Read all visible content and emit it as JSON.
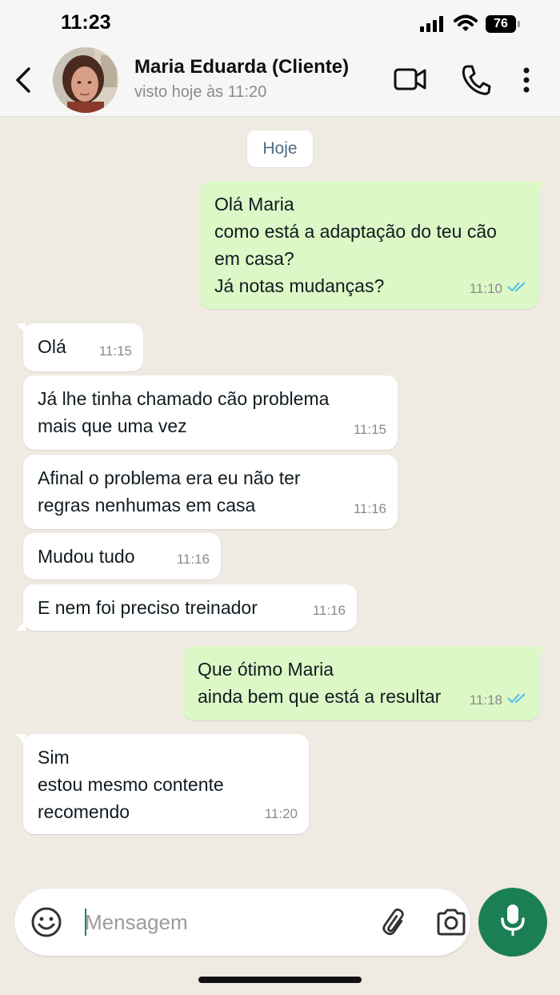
{
  "status_bar": {
    "time": "11:23",
    "battery": "76"
  },
  "header": {
    "contact_name": "Maria Eduarda (Cliente)",
    "last_seen": "visto hoje às 11:20"
  },
  "chat": {
    "day_label": "Hoje",
    "messages": [
      {
        "direction": "out",
        "text": "Olá Maria\ncomo está a adaptação do teu cão\nem casa?\nJá notas mudanças?",
        "time": "11:10",
        "read": true
      },
      {
        "direction": "in",
        "text": "Olá",
        "time": "11:15"
      },
      {
        "direction": "in",
        "text": "Já lhe tinha chamado cão problema\nmais que uma vez",
        "time": "11:15"
      },
      {
        "direction": "in",
        "text": "Afinal o problema era eu não ter\nregras nenhumas em casa",
        "time": "11:16"
      },
      {
        "direction": "in",
        "text": "Mudou tudo",
        "time": "11:16"
      },
      {
        "direction": "in",
        "text": "E nem foi preciso treinador",
        "time": "11:16"
      },
      {
        "direction": "out",
        "text": "Que ótimo Maria\nainda bem que está a resultar",
        "time": "11:18",
        "read": true
      },
      {
        "direction": "in",
        "text": "Sim\nestou mesmo contente\nrecomendo",
        "time": "11:20"
      }
    ]
  },
  "composer": {
    "placeholder": "Mensagem"
  },
  "colors": {
    "chat_background": "#efeae2",
    "outgoing_bubble": "#dcf8c6",
    "incoming_bubble": "#ffffff",
    "read_ticks": "#53bdeb",
    "accent": "#1b7f56"
  },
  "icons": [
    "back-chevron-icon",
    "video-camera-icon",
    "phone-icon",
    "more-vert-icon",
    "emoji-icon",
    "paperclip-icon",
    "camera-icon",
    "microphone-icon",
    "double-check-icon"
  ]
}
